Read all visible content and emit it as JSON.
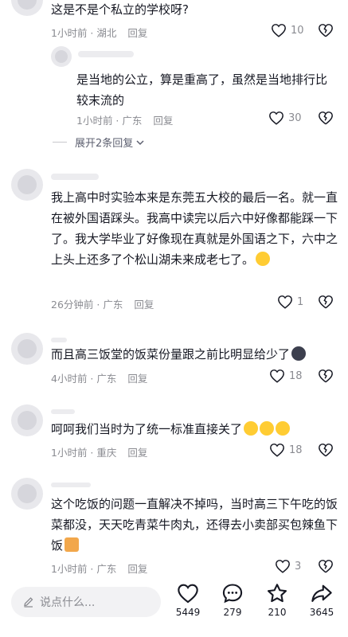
{
  "comments": [
    {
      "text": "这是不是个私立的学校呀?",
      "time_loc": "1小时前 · 湖北",
      "reply": "回复",
      "likes": "10"
    },
    {
      "text": "是当地的公立，算是重高了，虽然是当地排行比较末流的",
      "time_loc": "1小时前 · 广东",
      "reply": "回复",
      "likes": "30"
    },
    {
      "text": "我上高中时实验本来是东莞五大校的最后一名。就一直在被外国语踩头。我高中读完以后六中好像都能踩一下了。我大学毕业了好像现在真就是外国语之下，六中之上头上还多了个松山湖未来成老七了。",
      "time_loc": "26分钟前 · 广东",
      "reply": "回复",
      "likes": "1"
    },
    {
      "text": "而且高三饭堂的饭菜份量跟之前比明显给少了",
      "time_loc": "4小时前 · 广东",
      "reply": "回复",
      "likes": "18"
    },
    {
      "text": "呵呵我们当时为了统一标准直接关了",
      "time_loc": "1小时前 · 重庆",
      "reply": "回复",
      "likes": "18"
    },
    {
      "text": "这个吃饭的问题一直解决不掉吗，当时高三下午吃的饭菜都没，天天吃青菜牛肉丸，还得去小卖部买包辣鱼下饭",
      "time_loc": "1小时前 · 广东",
      "reply": "回复",
      "likes": "3"
    }
  ],
  "expand_replies": "展开2条回复",
  "input_placeholder": "说点什么...",
  "actions": {
    "likes": "5449",
    "comments": "279",
    "favorites": "210",
    "shares": "3645"
  }
}
